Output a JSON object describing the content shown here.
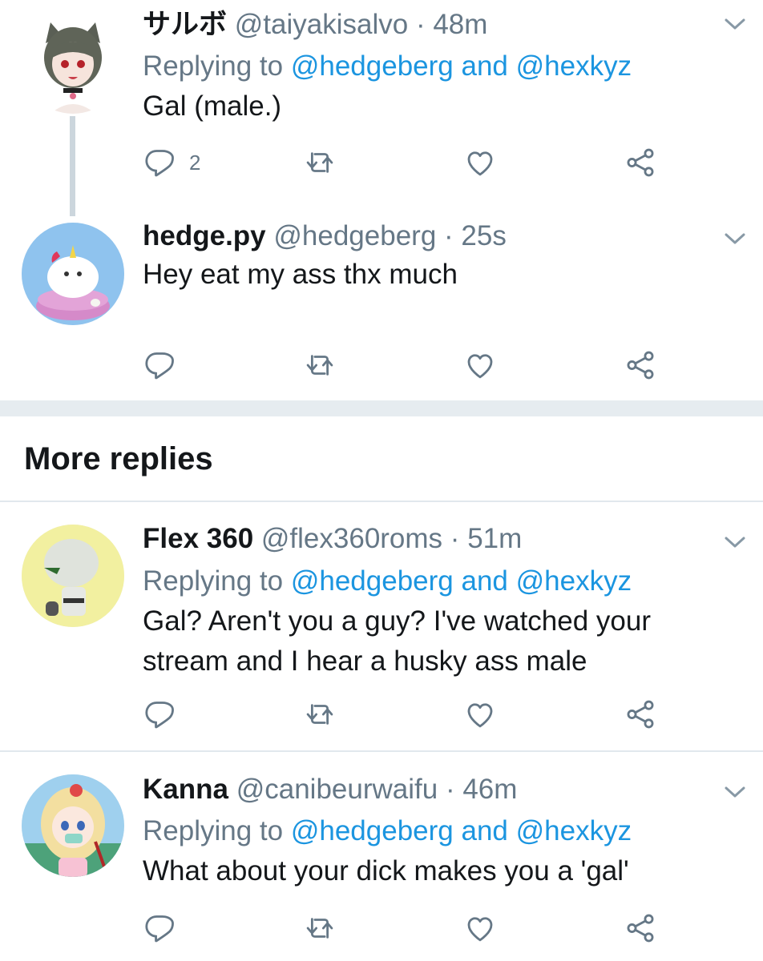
{
  "tweets": [
    {
      "name": "サルボ",
      "handle": "@taiyakisalvo",
      "dot": "·",
      "time": "48m",
      "replying_prefix": "Replying to",
      "mention1": "@hedgeberg",
      "conj": "and",
      "mention2": "@hexkyz",
      "text": "Gal (male.)",
      "reply_count": "2"
    },
    {
      "name": "hedge.py",
      "handle": "@hedgeberg",
      "dot": "·",
      "time": "25s",
      "text": "Hey eat my ass thx much"
    },
    {
      "name": "Flex 360",
      "handle": "@flex360roms",
      "dot": "·",
      "time": "51m",
      "replying_prefix": "Replying to",
      "mention1": "@hedgeberg",
      "conj": "and",
      "mention2": "@hexkyz",
      "text_line1": "Gal? Aren't you a guy? I've watched your",
      "text_line2": "stream and I hear a husky ass male"
    },
    {
      "name": "Kanna",
      "handle": "@canibeurwaifu",
      "dot": "·",
      "time": "46m",
      "replying_prefix": "Replying to",
      "mention1": "@hedgeberg",
      "conj": "and",
      "mention2": "@hexkyz",
      "text": "What about your dick makes you a 'gal'"
    }
  ],
  "section_title": "More replies",
  "icons": {
    "reply": "reply-icon",
    "retweet": "retweet-icon",
    "like": "heart-icon",
    "share": "share-icon",
    "menu": "chevron-down-icon"
  },
  "colors": {
    "link": "#1b95e0",
    "muted": "#657786",
    "text": "#14171a",
    "divider": "#e6ecf0"
  }
}
